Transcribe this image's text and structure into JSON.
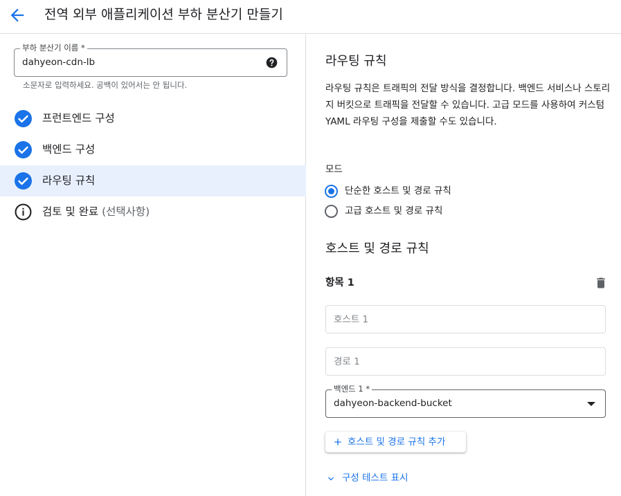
{
  "header": {
    "title": "전역 외부 애플리케이션 부하 분산기 만들기",
    "back_icon": "arrow-back-icon"
  },
  "left": {
    "lb_name": {
      "label": "부하 분산기 이름 *",
      "value": "dahyeon-cdn-lb",
      "hint": "소문자로 입력하세요. 공백이 있어서는 안 됩니다.",
      "help_icon": "help-circle-icon"
    },
    "steps": [
      {
        "label": "프런트엔드 구성",
        "optional": "",
        "status": "complete",
        "icon": "check-circle-icon"
      },
      {
        "label": "백엔드 구성",
        "optional": "",
        "status": "complete",
        "icon": "check-circle-icon"
      },
      {
        "label": "라우팅 규칙",
        "optional": "",
        "status": "complete",
        "active": true,
        "icon": "check-circle-icon"
      },
      {
        "label": "검토 및 완료",
        "optional": "(선택사항)",
        "status": "info",
        "icon": "info-icon"
      }
    ]
  },
  "right": {
    "title": "라우팅 규칙",
    "description": "라우팅 규칙은 트래픽의 전달 방식을 결정합니다. 백엔드 서비스나 스토리지 버킷으로 트래픽을 전달할 수 있습니다. 고급 모드를 사용하여 커스텀 YAML 라우팅 구성을 제출할 수도 있습니다.",
    "mode": {
      "label": "모드",
      "options": [
        {
          "label": "단순한 호스트 및 경로 규칙",
          "selected": true
        },
        {
          "label": "고급 호스트 및 경로 규칙",
          "selected": false
        }
      ]
    },
    "host_path": {
      "title": "호스트 및 경로 규칙",
      "item_title": "항목 1",
      "host_placeholder": "호스트 1",
      "host_value": "",
      "path_placeholder": "경로 1",
      "path_value": "",
      "backend_label": "백엔드 1 *",
      "backend_value": "dahyeon-backend-bucket",
      "add_button": "호스트 및 경로 규칙 추가",
      "test_link": "구성 테스트 표시"
    }
  },
  "colors": {
    "accent": "#1a73e8",
    "active_bg": "#e8f0fe",
    "text": "#202124",
    "secondary_text": "#5f6368",
    "border": "#dadce0"
  }
}
